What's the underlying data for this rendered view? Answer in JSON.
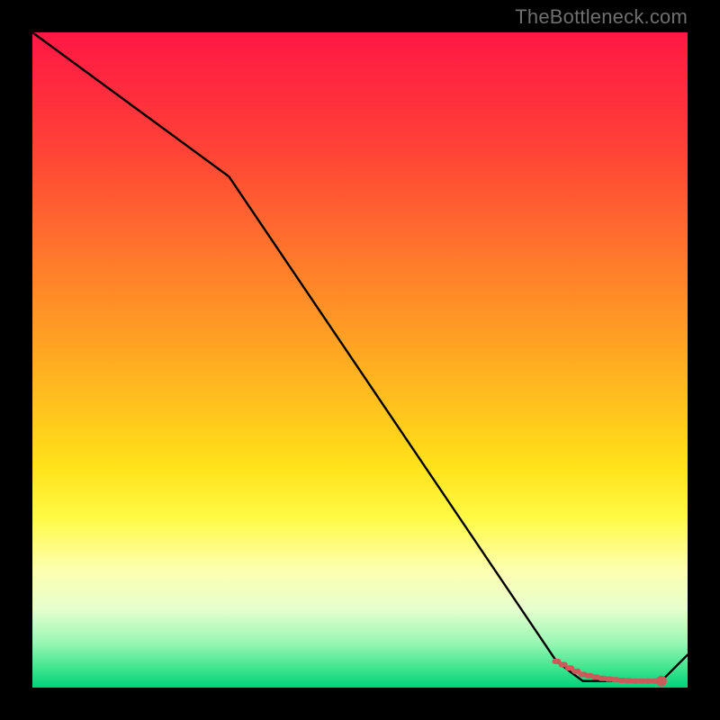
{
  "watermark": "TheBottleneck.com",
  "chart_data": {
    "type": "line",
    "title": "",
    "xlabel": "",
    "ylabel": "",
    "xlim": [
      0,
      100
    ],
    "ylim": [
      0,
      100
    ],
    "background": "red-to-green vertical gradient (bottleneck heat map)",
    "series": [
      {
        "name": "bottleneck-curve",
        "color": "#000000",
        "x": [
          0,
          30,
          80,
          84,
          92,
          96,
          100
        ],
        "values": [
          100,
          78,
          4,
          1,
          1,
          1,
          5
        ]
      }
    ],
    "markers": {
      "name": "highlighted-range",
      "color": "#cc5a5a",
      "points_x": [
        80,
        81,
        82,
        83,
        84,
        85,
        86,
        87,
        88,
        89,
        90,
        91,
        92,
        93,
        94,
        95,
        96
      ],
      "points_y": [
        4,
        3.5,
        3,
        2.5,
        2,
        1.8,
        1.6,
        1.4,
        1.3,
        1.2,
        1.1,
        1.05,
        1,
        1,
        1,
        1,
        1
      ]
    }
  }
}
